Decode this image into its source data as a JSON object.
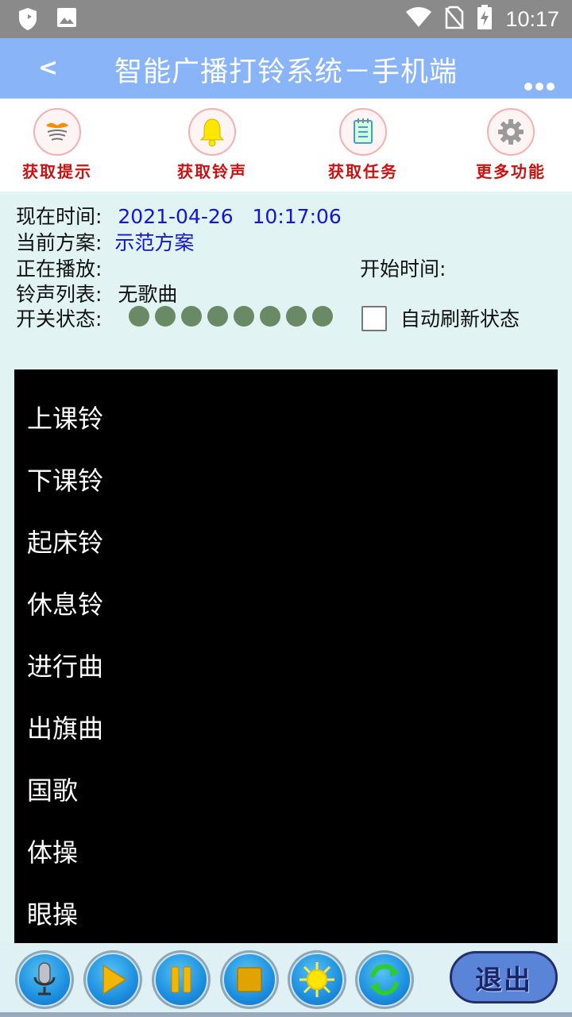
{
  "status_bar": {
    "time": "10:17",
    "left_icons": [
      "shield-icon",
      "image-icon"
    ],
    "right_icons": [
      "wifi-icon",
      "no-sim-icon",
      "battery-charging-icon"
    ]
  },
  "header": {
    "back_label": "<",
    "title": "智能广播打铃系统－手机端",
    "more_icon": "more-dots-icon"
  },
  "toolbar": {
    "items": [
      {
        "label": "获取提示",
        "icon": "lips-sound-icon"
      },
      {
        "label": "获取铃声",
        "icon": "bell-icon"
      },
      {
        "label": "获取任务",
        "icon": "notepad-icon"
      },
      {
        "label": "更多功能",
        "icon": "gear-icon"
      }
    ]
  },
  "info": {
    "time_label": "现在时间:",
    "time_value": "2021-04-26   10:17:06",
    "plan_label": "当前方案:",
    "plan_value": "示范方案",
    "playing_label": "正在播放:",
    "start_label": "开始时间:",
    "ringtone_label": "铃声列表:",
    "ringtone_value": "无歌曲",
    "switch_label": "开关状态:",
    "switch_count": 8,
    "switch_color": "#6a8a66",
    "auto_refresh_label": "自动刷新状态",
    "auto_refresh_checked": false
  },
  "songs": [
    "上课铃",
    "下课铃",
    "起床铃",
    "休息铃",
    "进行曲",
    "出旗曲",
    "国歌",
    "体操",
    "眼操"
  ],
  "controls": {
    "buttons": [
      "microphone-icon",
      "play-icon",
      "pause-icon",
      "stop-icon",
      "sun-icon",
      "refresh-icon"
    ],
    "exit_label": "退出"
  },
  "colors": {
    "title_bar": "#8ab4f8",
    "toolbar_label": "#cc1111",
    "info_value": "#1414d6",
    "list_bg": "#000000"
  }
}
